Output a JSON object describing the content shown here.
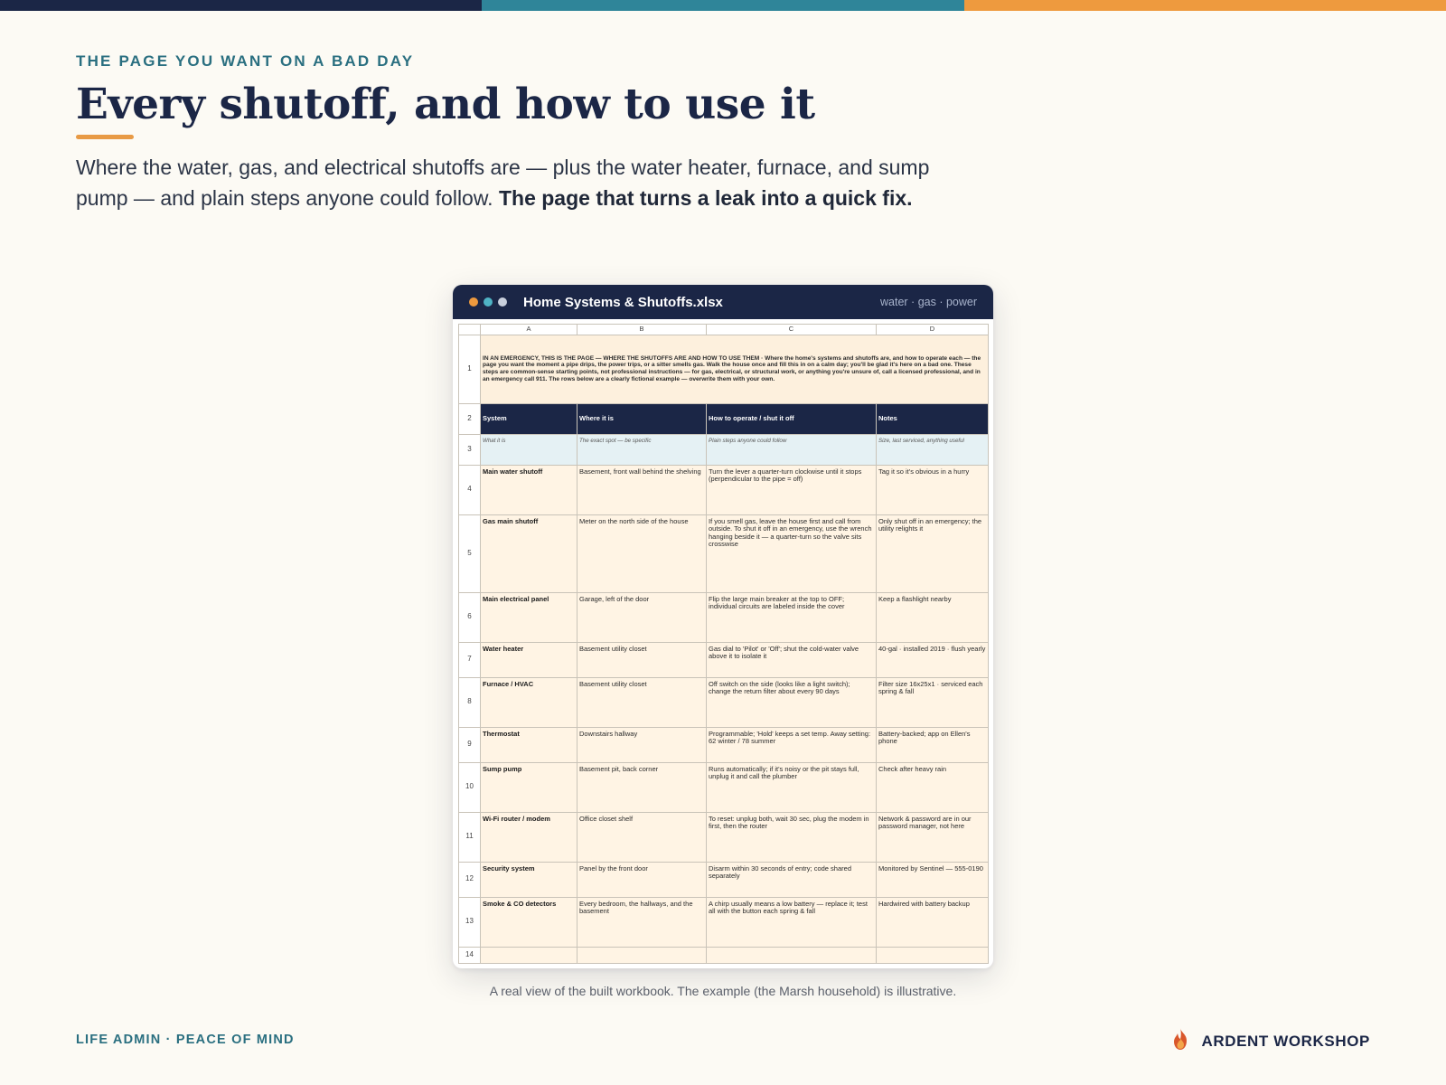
{
  "colors": {
    "navy": "#1b2646",
    "teal": "#2f8599",
    "orange": "#ee9a3e",
    "background": "#fcfaf4"
  },
  "eyebrow": "THE PAGE YOU WANT ON A BAD DAY",
  "headline": "Every shutoff, and how to use it",
  "lede": {
    "plain": "Where the water, gas, and electrical shutoffs are — plus the water heater, furnace, and sump pump — and plain steps anyone could follow.",
    "bold": "The page that turns a leak into a quick fix."
  },
  "window": {
    "title": "Home Systems & Shutoffs.xlsx",
    "tag": "water · gas · power",
    "dots": [
      "#ee9a3e",
      "#4fb3c4",
      "#c9cfdc"
    ]
  },
  "sheet": {
    "columns": [
      "A",
      "B",
      "C",
      "D"
    ],
    "note": "IN AN EMERGENCY, THIS IS THE PAGE — WHERE THE SHUTOFFS ARE AND HOW TO USE THEM · Where the home's systems and shutoffs are, and how to operate each — the page you want the moment a pipe drips, the power trips, or a sitter smells gas. Walk the house once and fill this in on a calm day; you'll be glad it's here on a bad one. These steps are common-sense starting points, not professional instructions — for gas, electrical, or structural work, or anything you're unsure of, call a licensed professional, and in an emergency call 911. The rows below are a clearly fictional example — overwrite them with your own.",
    "headers": [
      "System",
      "Where it is",
      "How to operate / shut it off",
      "Notes"
    ],
    "hints": [
      "What it is",
      "The exact spot — be specific",
      "Plain steps anyone could follow",
      "Size, last serviced, anything useful"
    ],
    "rows": [
      [
        "Main water shutoff",
        "Basement, front wall behind the shelving",
        "Turn the lever a quarter-turn clockwise until it stops (perpendicular to the pipe = off)",
        "Tag it so it's obvious in a hurry"
      ],
      [
        "Gas main shutoff",
        "Meter on the north side of the house",
        "If you smell gas, leave the house first and call from outside. To shut it off in an emergency, use the wrench hanging beside it — a quarter-turn so the valve sits crosswise",
        "Only shut off in an emergency; the utility relights it"
      ],
      [
        "Main electrical panel",
        "Garage, left of the door",
        "Flip the large main breaker at the top to OFF; individual circuits are labeled inside the cover",
        "Keep a flashlight nearby"
      ],
      [
        "Water heater",
        "Basement utility closet",
        "Gas dial to 'Pilot' or 'Off'; shut the cold-water valve above it to isolate it",
        "40-gal · installed 2019 · flush yearly"
      ],
      [
        "Furnace / HVAC",
        "Basement utility closet",
        "Off switch on the side (looks like a light switch); change the return filter about every 90 days",
        "Filter size 16x25x1 · serviced each spring & fall"
      ],
      [
        "Thermostat",
        "Downstairs hallway",
        "Programmable; 'Hold' keeps a set temp. Away setting: 62 winter / 78 summer",
        "Battery-backed; app on Ellen's phone"
      ],
      [
        "Sump pump",
        "Basement pit, back corner",
        "Runs automatically; if it's noisy or the pit stays full, unplug it and call the plumber",
        "Check after heavy rain"
      ],
      [
        "Wi-Fi router / modem",
        "Office closet shelf",
        "To reset: unplug both, wait 30 sec, plug the modem in first, then the router",
        "Network & password are in our password manager, not here"
      ],
      [
        "Security system",
        "Panel by the front door",
        "Disarm within 30 seconds of entry; code shared separately",
        "Monitored by Sentinel — 555-0190"
      ],
      [
        "Smoke & CO detectors",
        "Every bedroom, the hallways, and the basement",
        "A chirp usually means a low battery — replace it; test all with the button each spring & fall",
        "Hardwired with battery backup"
      ]
    ],
    "row_numbers": [
      "1",
      "2",
      "3",
      "4",
      "5",
      "6",
      "7",
      "8",
      "9",
      "10",
      "11",
      "12",
      "13",
      "14"
    ]
  },
  "caption": "A real view of the built workbook. The example (the Marsh household) is illustrative.",
  "footer": {
    "left": "LIFE ADMIN · PEACE OF MIND",
    "brand": "ARDENT WORKSHOP"
  }
}
